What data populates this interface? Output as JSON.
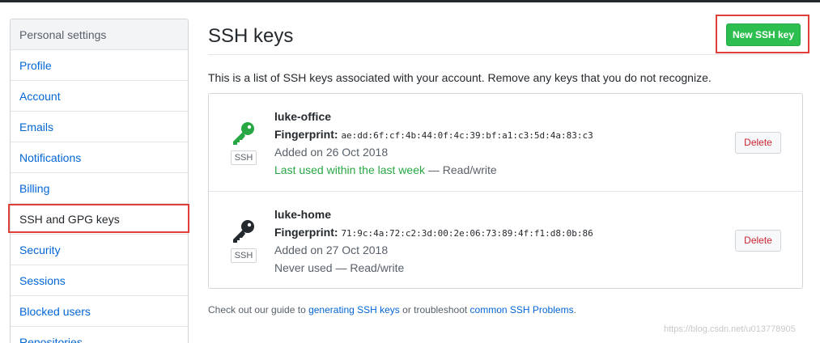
{
  "sidebar": {
    "header": "Personal settings",
    "items": [
      {
        "label": "Profile"
      },
      {
        "label": "Account"
      },
      {
        "label": "Emails"
      },
      {
        "label": "Notifications"
      },
      {
        "label": "Billing"
      },
      {
        "label": "SSH and GPG keys"
      },
      {
        "label": "Security"
      },
      {
        "label": "Sessions"
      },
      {
        "label": "Blocked users"
      },
      {
        "label": "Repositories"
      }
    ],
    "selected": "SSH and GPG keys"
  },
  "main": {
    "title": "SSH keys",
    "new_key_label": "New SSH key",
    "intro": "This is a list of SSH keys associated with your account. Remove any keys that you do not recognize.",
    "keys": [
      {
        "title": "luke-office",
        "badge": "SSH",
        "fingerprint_label": "Fingerprint:",
        "fingerprint": "ae:dd:6f:cf:4b:44:0f:4c:39:bf:a1:c3:5d:4a:83:c3",
        "added": "Added on 26 Oct 2018",
        "usage_highlight": "Last used within the last week",
        "usage_rest": " — Read/write",
        "icon_color": "#28a745",
        "delete_label": "Delete"
      },
      {
        "title": "luke-home",
        "badge": "SSH",
        "fingerprint_label": "Fingerprint:",
        "fingerprint": "71:9c:4a:72:c2:3d:00:2e:06:73:89:4f:f1:d8:0b:86",
        "added": "Added on 27 Oct 2018",
        "usage_highlight": "",
        "usage_rest": "Never used — Read/write",
        "icon_color": "#24292e",
        "delete_label": "Delete"
      }
    ],
    "footer": {
      "prefix": "Check out our guide to ",
      "link1": "generating SSH keys",
      "middle": " or troubleshoot ",
      "link2": "common SSH Problems",
      "suffix": "."
    }
  },
  "watermark": "https://blog.csdn.net/u013778905",
  "colors": {
    "accent_link": "#0366d6",
    "primary_button": "#2cbe4e",
    "danger": "#cb2431",
    "highlight_box": "#e0403a"
  }
}
